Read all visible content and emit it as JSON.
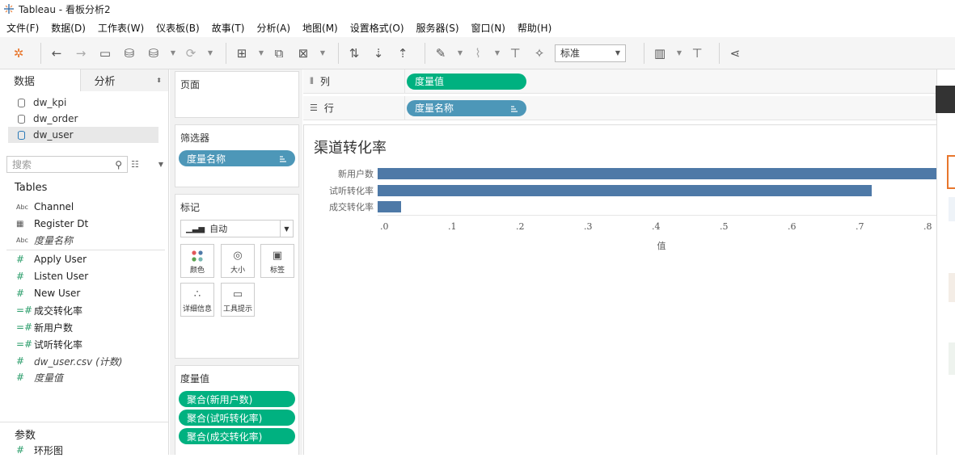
{
  "app": {
    "title": "Tableau - 看板分析2"
  },
  "menu": [
    "文件(F)",
    "数据(D)",
    "工作表(W)",
    "仪表板(B)",
    "故事(T)",
    "分析(A)",
    "地图(M)",
    "设置格式(O)",
    "服务器(S)",
    "窗口(N)",
    "帮助(H)"
  ],
  "toolbar": {
    "fit_value": "标准"
  },
  "left": {
    "tab_data": "数据",
    "tab_analysis": "分析",
    "datasources": [
      "dw_kpi",
      "dw_order",
      "dw_user"
    ],
    "selected_datasource": "dw_user",
    "search_placeholder": "搜索",
    "tables_heading": "Tables",
    "dimensions": [
      {
        "type": "Abc",
        "name": "Channel"
      },
      {
        "type": "cal",
        "name": "Register Dt"
      },
      {
        "type": "Abc",
        "name": "度量名称",
        "italic": true
      }
    ],
    "measures": [
      {
        "type": "#",
        "name": "Apply User"
      },
      {
        "type": "#",
        "name": "Listen User"
      },
      {
        "type": "#",
        "name": "New User"
      },
      {
        "type": "=#",
        "name": "成交转化率"
      },
      {
        "type": "=#",
        "name": "新用户数"
      },
      {
        "type": "=#",
        "name": "试听转化率"
      },
      {
        "type": "#",
        "name": "dw_user.csv (计数)",
        "italic": true
      },
      {
        "type": "#",
        "name": "度量值",
        "italic": true
      }
    ],
    "params_heading": "参数",
    "params": [
      {
        "type": "#",
        "name": "环形图"
      }
    ]
  },
  "cards": {
    "pages": "页面",
    "filters": "筛选器",
    "filter_pill": "度量名称",
    "marks": "标记",
    "mark_type": "自动",
    "mark_buttons": [
      "颜色",
      "大小",
      "标签",
      "详细信息",
      "工具提示"
    ],
    "measure_values": "度量值",
    "measure_pills": [
      "聚合(新用户数)",
      "聚合(试听转化率)",
      "聚合(成交转化率)"
    ]
  },
  "shelves": {
    "columns_label": "列",
    "columns_pill": "度量值",
    "rows_label": "行",
    "rows_pill": "度量名称"
  },
  "chart_data": {
    "type": "bar",
    "orientation": "horizontal",
    "title": "渠道转化率",
    "categories": [
      "新用户数",
      "试听转化率",
      "成交转化率"
    ],
    "values": [
      0.82,
      0.725,
      0.035
    ],
    "xlabel": "值",
    "xticks": [
      ".0",
      ".1",
      ".2",
      ".3",
      ".4",
      ".5",
      ".6",
      ".7",
      ".8"
    ],
    "xlim": [
      0,
      0.82
    ],
    "bar_color": "#4e79a7",
    "grid": false
  },
  "colors": {
    "blue_pill": "#4d97b8",
    "green_pill": "#00b180",
    "bar": "#4e79a7"
  }
}
